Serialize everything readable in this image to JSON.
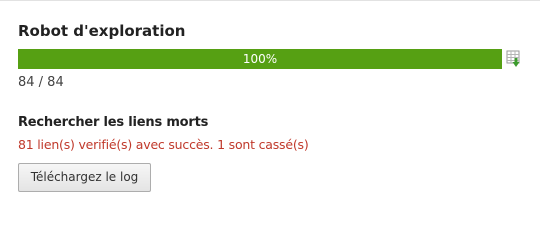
{
  "crawler": {
    "title": "Robot d'exploration",
    "progress": {
      "label": "100%",
      "percent": 100,
      "count": "84 / 84",
      "fill_color": "#56a013"
    },
    "export_icon": "spreadsheet-export-icon"
  },
  "dead_links": {
    "heading": "Rechercher les liens morts",
    "result": "81 lien(s) verifié(s) avec succès. 1 sont cassé(s)",
    "result_color": "#c0392b",
    "download_label": "Téléchargez le log"
  }
}
